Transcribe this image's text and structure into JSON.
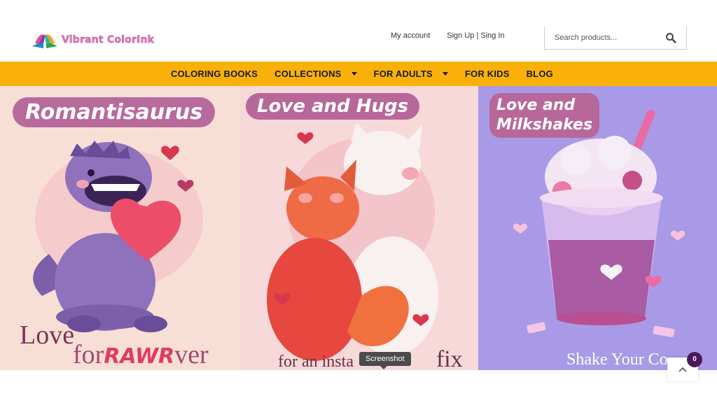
{
  "brand": {
    "name": "Vibrant ColorInk"
  },
  "toplinks": {
    "account": "My account",
    "auth": "Sign Up | Sing In"
  },
  "search": {
    "placeholder": "Search products..."
  },
  "nav": {
    "items": [
      {
        "label": "COLORING BOOKS",
        "dropdown": false
      },
      {
        "label": "COLLECTIONS",
        "dropdown": true
      },
      {
        "label": "FOR ADULTS",
        "dropdown": true
      },
      {
        "label": "FOR KIDS",
        "dropdown": false
      },
      {
        "label": "BLOG",
        "dropdown": false
      }
    ]
  },
  "banner": {
    "panels": [
      {
        "title": "Romantisaurus",
        "subtitle_a": "Love",
        "subtitle_b_prefix": "for",
        "subtitle_b_bold": "RAWR",
        "subtitle_b_suffix": "ver"
      },
      {
        "title": "Love and Hugs",
        "subtitle": "for an insta",
        "subtitle_fix": "fix"
      },
      {
        "title_line1": "Love and",
        "title_line2": "Milkshakes",
        "subtitle": "Shake Your Co"
      }
    ]
  },
  "tooltip": {
    "text": "Screenshot"
  },
  "cart": {
    "count": "0"
  },
  "colors": {
    "accent": "#f9b10a",
    "brand_pink": "#f07aa8",
    "brand_purple": "#8a3fa0"
  }
}
